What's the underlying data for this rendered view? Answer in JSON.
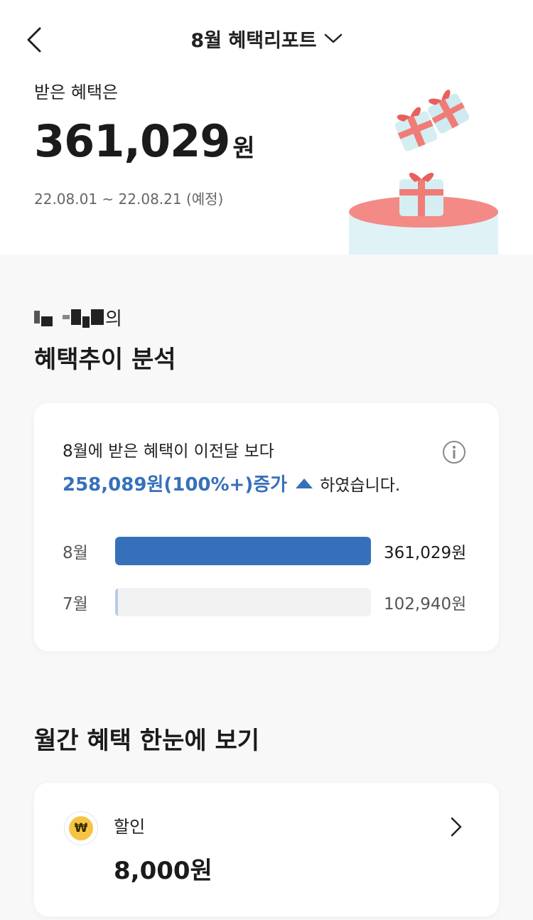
{
  "header": {
    "title": "8월 혜택리포트"
  },
  "summary": {
    "label": "받은 혜택은",
    "amount": "361,029",
    "unit": "원",
    "period": "22.08.01 ~ 22.08.21 (예정)"
  },
  "trend": {
    "owner_suffix": "의",
    "section_title": "혜택추이 분석",
    "line1": "8월에 받은 혜택이 이전달 보다",
    "highlight": "258,089원(100%+)증가",
    "tail": "하였습니다.",
    "accent_color": "#3670bb",
    "bars": [
      {
        "month": "8월",
        "value_label": "361,029원",
        "value": 361029,
        "fill_fraction": 1.0,
        "color": "#3670bb"
      },
      {
        "month": "7월",
        "value_label": "102,940원",
        "value": 102940,
        "fill_fraction": 0.01,
        "color": "#b9c9ea"
      }
    ]
  },
  "monthly": {
    "section_title": "월간 혜택 한눈에 보기",
    "items": [
      {
        "label": "할인",
        "value": "8,000원",
        "icon": "won-coin-icon",
        "icon_text": "₩"
      }
    ]
  }
}
